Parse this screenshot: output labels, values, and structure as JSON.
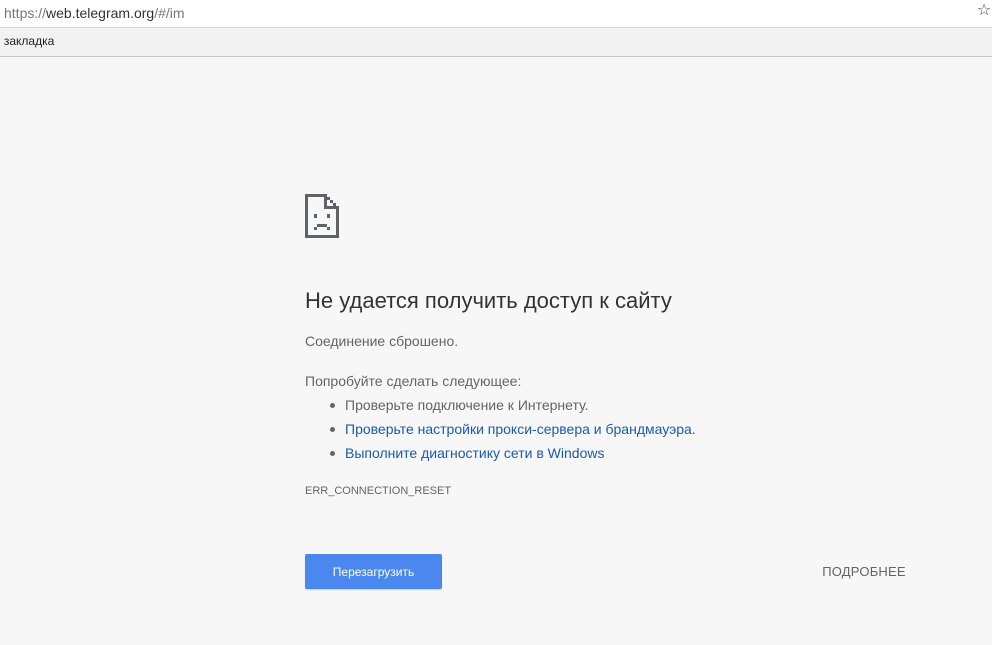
{
  "browser": {
    "url_scheme": "https://",
    "url_host": "web.telegram.org",
    "url_path": "/#/im",
    "bookmark_label": "я закладка",
    "bookmark_icon": "star-icon"
  },
  "error_page": {
    "icon": "sad-page-icon",
    "title": "Не удается получить доступ к сайту",
    "subtitle": "Соединение сброшено.",
    "try_label": "Попробуйте сделать следующее:",
    "suggestions": [
      "Проверьте подключение к Интернету.",
      "Проверьте настройки прокси-сервера и брандмауэра.",
      "Выполните диагностику сети в Windows"
    ],
    "error_code": "ERR_CONNECTION_RESET",
    "reload_label": "Перезагрузить",
    "details_label": "ПОДРОБНЕЕ"
  },
  "colors": {
    "background": "#f7f7f7",
    "button_blue": "#4a87ee",
    "link_blue": "#1a5ab0",
    "text_gray": "#646464"
  }
}
